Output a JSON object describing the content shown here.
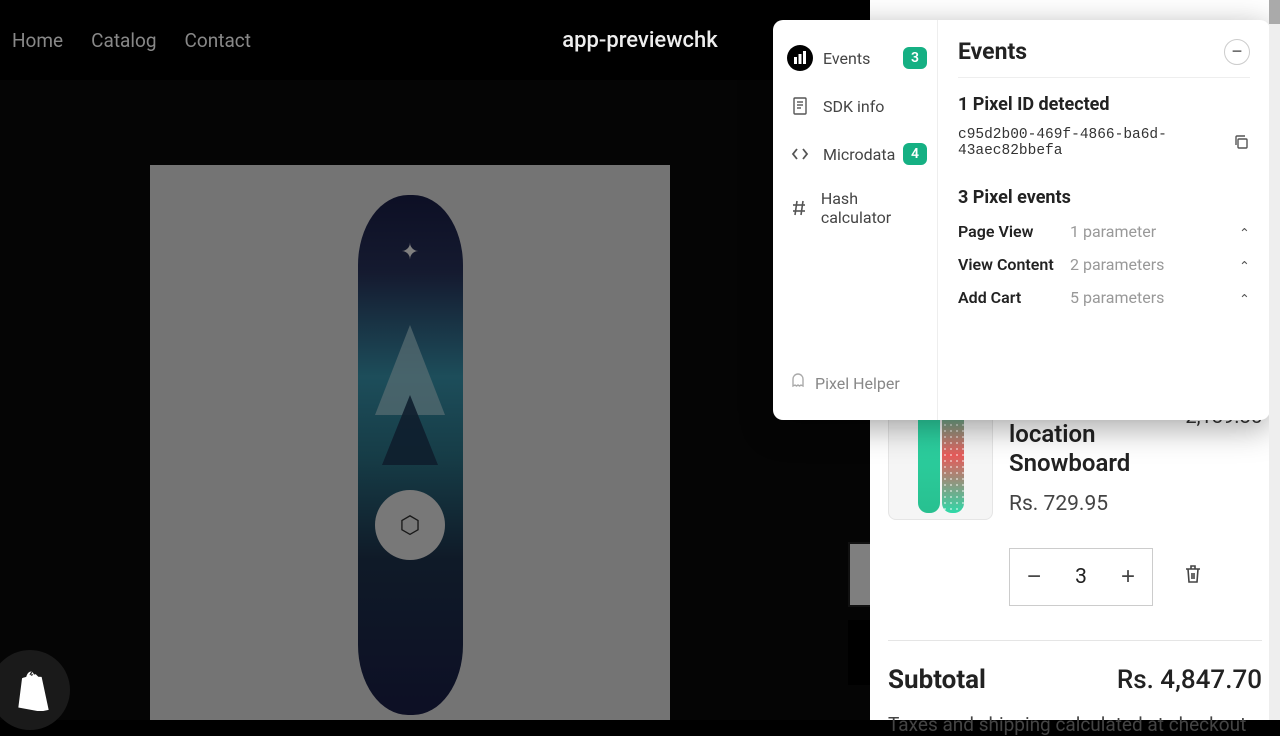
{
  "header": {
    "nav": [
      "Home",
      "Catalog",
      "Contact"
    ],
    "brand": "app-previewchk"
  },
  "cart": {
    "item": {
      "title_line1": "location",
      "title_line2": "Snowboard",
      "unit_price": "Rs. 729.95",
      "line_price": "2,189.85",
      "quantity": "3"
    },
    "subtotal_label": "Subtotal",
    "subtotal_value": "Rs. 4,847.70",
    "tax_note": "Taxes and shipping calculated at checkout"
  },
  "popup": {
    "sidebar": {
      "events": {
        "label": "Events",
        "badge": "3"
      },
      "sdk": {
        "label": "SDK info"
      },
      "microdata": {
        "label": "Microdata",
        "badge": "4"
      },
      "hash": {
        "label": "Hash calculator"
      },
      "footer": "Pixel Helper"
    },
    "main": {
      "title": "Events",
      "detect_title": "1 Pixel ID detected",
      "pixel_id": "c95d2b00-469f-4866-ba6d-43aec82bbefa",
      "events_title": "3 Pixel events",
      "events": [
        {
          "name": "Page View",
          "params": "1 parameter"
        },
        {
          "name": "View Content",
          "params": "2 parameters"
        },
        {
          "name": "Add Cart",
          "params": "5 parameters"
        }
      ]
    }
  }
}
